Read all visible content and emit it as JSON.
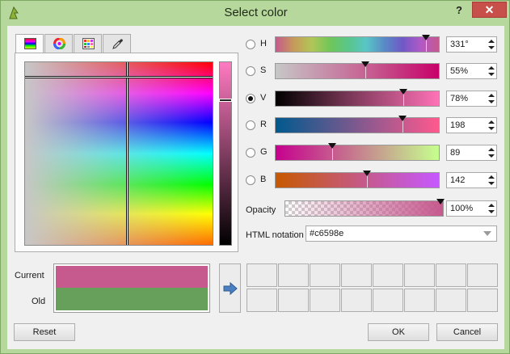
{
  "window": {
    "title": "Select color",
    "help_label": "?",
    "close_label": "✕"
  },
  "tabs": [
    {
      "name": "color-ramp-tab",
      "icon": "color-ramp-icon",
      "active": true
    },
    {
      "name": "color-wheel-tab",
      "icon": "color-wheel-icon",
      "active": false
    },
    {
      "name": "swatches-tab",
      "icon": "swatch-grid-icon",
      "active": false
    },
    {
      "name": "sampler-tab",
      "icon": "eyedropper-icon",
      "active": false
    }
  ],
  "components": [
    {
      "key": "H",
      "label": "H",
      "value": "331°",
      "selected": false,
      "gradient": "linear-gradient(to right,#c6598e,#c69a59,#b1c659,#6fc659,#59c68a,#59c6c6,#598ac6,#6f59c6,#b159c6,#c6598e)",
      "marker_fraction": 0.92
    },
    {
      "key": "S",
      "label": "S",
      "value": "55%",
      "selected": false,
      "gradient": "linear-gradient(to right,#c7c7c7,#c6598e 60%,#c7006a)",
      "marker_fraction": 0.55
    },
    {
      "key": "V",
      "label": "V",
      "value": "78%",
      "selected": true,
      "gradient": "linear-gradient(to right,#000000,#7a3757 45%,#ff72b7)",
      "marker_fraction": 0.78
    },
    {
      "key": "R",
      "label": "R",
      "value": "198",
      "selected": false,
      "gradient": "linear-gradient(to right,#00598e,#ff598e)",
      "marker_fraction": 0.776
    },
    {
      "key": "G",
      "label": "G",
      "value": "89",
      "selected": false,
      "gradient": "linear-gradient(to right,#c6008e,#c6ff8e)",
      "marker_fraction": 0.349
    },
    {
      "key": "B",
      "label": "B",
      "value": "142",
      "selected": false,
      "gradient": "linear-gradient(to right,#c65900,#c659ff)",
      "marker_fraction": 0.557
    }
  ],
  "opacity": {
    "label": "Opacity",
    "value": "100%"
  },
  "html_notation": {
    "label": "HTML notation",
    "value": "#c6598e"
  },
  "preview": {
    "current_label": "Current",
    "old_label": "Old",
    "current_color": "#c6598e",
    "old_color": "#66a05a"
  },
  "buttons": {
    "reset": "Reset",
    "ok": "OK",
    "cancel": "Cancel"
  },
  "colors": {
    "accent": "#c6598e",
    "close": "#c7514a",
    "arrow": "#4a7fc1"
  }
}
